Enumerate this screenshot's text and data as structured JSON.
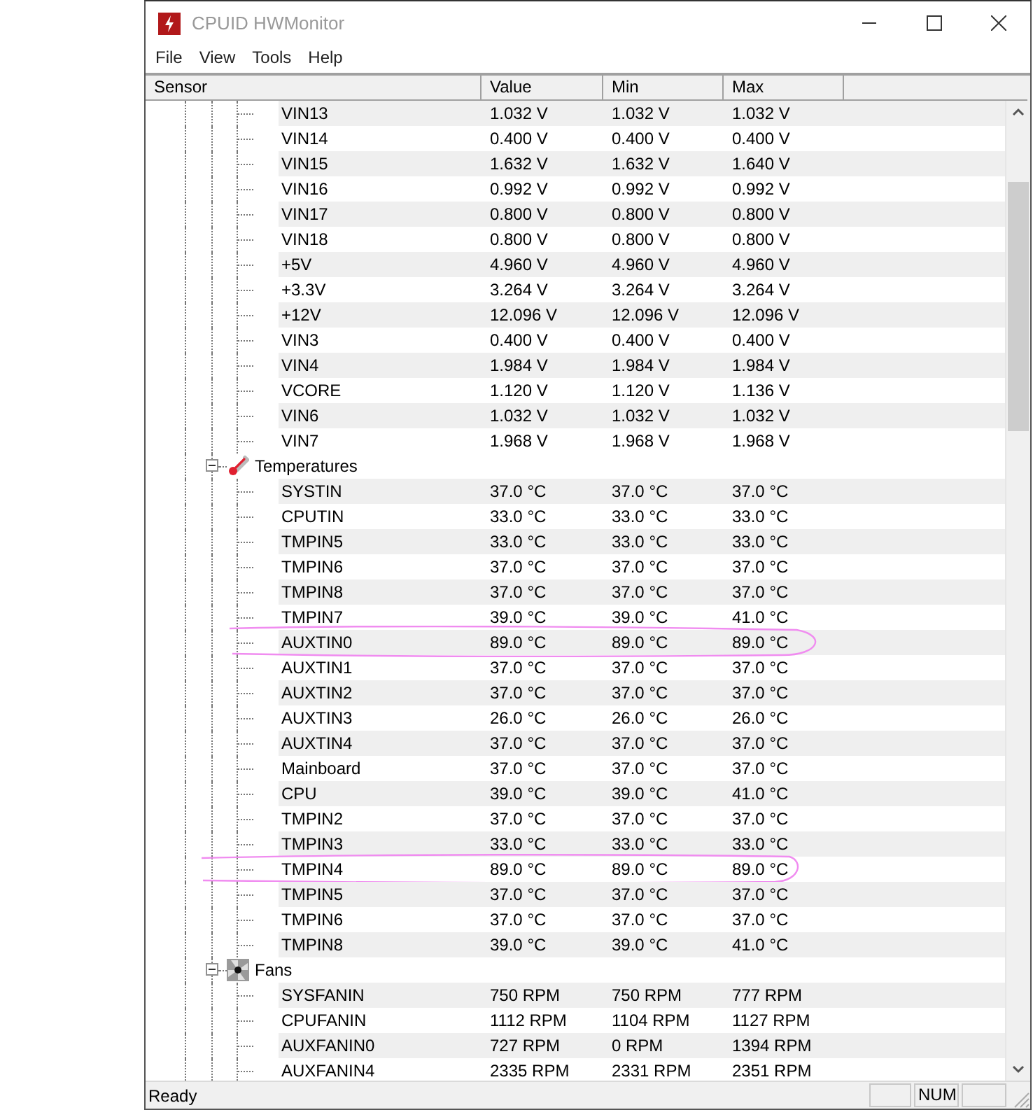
{
  "window": {
    "title": "CPUID HWMonitor"
  },
  "menu": [
    "File",
    "View",
    "Tools",
    "Help"
  ],
  "columns": [
    "Sensor",
    "Value",
    "Min",
    "Max"
  ],
  "sections": [
    {
      "rows": [
        {
          "name": "VIN13",
          "value": "1.032 V",
          "min": "1.032 V",
          "max": "1.032 V",
          "highlighted": false
        },
        {
          "name": "VIN14",
          "value": "0.400 V",
          "min": "0.400 V",
          "max": "0.400 V",
          "highlighted": false
        },
        {
          "name": "VIN15",
          "value": "1.632 V",
          "min": "1.632 V",
          "max": "1.640 V",
          "highlighted": false
        },
        {
          "name": "VIN16",
          "value": "0.992 V",
          "min": "0.992 V",
          "max": "0.992 V",
          "highlighted": false
        },
        {
          "name": "VIN17",
          "value": "0.800 V",
          "min": "0.800 V",
          "max": "0.800 V",
          "highlighted": false
        },
        {
          "name": "VIN18",
          "value": "0.800 V",
          "min": "0.800 V",
          "max": "0.800 V",
          "highlighted": false
        },
        {
          "name": "+5V",
          "value": "4.960 V",
          "min": "4.960 V",
          "max": "4.960 V",
          "highlighted": false
        },
        {
          "name": "+3.3V",
          "value": "3.264 V",
          "min": "3.264 V",
          "max": "3.264 V",
          "highlighted": false
        },
        {
          "name": "+12V",
          "value": "12.096 V",
          "min": "12.096 V",
          "max": "12.096 V",
          "highlighted": false
        },
        {
          "name": "VIN3",
          "value": "0.400 V",
          "min": "0.400 V",
          "max": "0.400 V",
          "highlighted": false
        },
        {
          "name": "VIN4",
          "value": "1.984 V",
          "min": "1.984 V",
          "max": "1.984 V",
          "highlighted": false
        },
        {
          "name": "VCORE",
          "value": "1.120 V",
          "min": "1.120 V",
          "max": "1.136 V",
          "highlighted": false
        },
        {
          "name": "VIN6",
          "value": "1.032 V",
          "min": "1.032 V",
          "max": "1.032 V",
          "highlighted": false
        },
        {
          "name": "VIN7",
          "value": "1.968 V",
          "min": "1.968 V",
          "max": "1.968 V",
          "highlighted": false
        }
      ]
    },
    {
      "label": "Temperatures",
      "kind": "temperatures",
      "expanded": true,
      "rows": [
        {
          "name": "SYSTIN",
          "value": "37.0 °C",
          "min": "37.0 °C",
          "max": "37.0 °C",
          "highlighted": false
        },
        {
          "name": "CPUTIN",
          "value": "33.0 °C",
          "min": "33.0 °C",
          "max": "33.0 °C",
          "highlighted": false
        },
        {
          "name": "TMPIN5",
          "value": "33.0 °C",
          "min": "33.0 °C",
          "max": "33.0 °C",
          "highlighted": false
        },
        {
          "name": "TMPIN6",
          "value": "37.0 °C",
          "min": "37.0 °C",
          "max": "37.0 °C",
          "highlighted": false
        },
        {
          "name": "TMPIN8",
          "value": "37.0 °C",
          "min": "37.0 °C",
          "max": "37.0 °C",
          "highlighted": false
        },
        {
          "name": "TMPIN7",
          "value": "39.0 °C",
          "min": "39.0 °C",
          "max": "41.0 °C",
          "highlighted": false
        },
        {
          "name": "AUXTIN0",
          "value": "89.0 °C",
          "min": "89.0 °C",
          "max": "89.0 °C",
          "highlighted": true
        },
        {
          "name": "AUXTIN1",
          "value": "37.0 °C",
          "min": "37.0 °C",
          "max": "37.0 °C",
          "highlighted": false
        },
        {
          "name": "AUXTIN2",
          "value": "37.0 °C",
          "min": "37.0 °C",
          "max": "37.0 °C",
          "highlighted": false
        },
        {
          "name": "AUXTIN3",
          "value": "26.0 °C",
          "min": "26.0 °C",
          "max": "26.0 °C",
          "highlighted": false
        },
        {
          "name": "AUXTIN4",
          "value": "37.0 °C",
          "min": "37.0 °C",
          "max": "37.0 °C",
          "highlighted": false
        },
        {
          "name": "Mainboard",
          "value": "37.0 °C",
          "min": "37.0 °C",
          "max": "37.0 °C",
          "highlighted": false
        },
        {
          "name": "CPU",
          "value": "39.0 °C",
          "min": "39.0 °C",
          "max": "41.0 °C",
          "highlighted": false
        },
        {
          "name": "TMPIN2",
          "value": "37.0 °C",
          "min": "37.0 °C",
          "max": "37.0 °C",
          "highlighted": false
        },
        {
          "name": "TMPIN3",
          "value": "33.0 °C",
          "min": "33.0 °C",
          "max": "33.0 °C",
          "highlighted": false
        },
        {
          "name": "TMPIN4",
          "value": "89.0 °C",
          "min": "89.0 °C",
          "max": "89.0 °C",
          "highlighted": true
        },
        {
          "name": "TMPIN5",
          "value": "37.0 °C",
          "min": "37.0 °C",
          "max": "37.0 °C",
          "highlighted": false
        },
        {
          "name": "TMPIN6",
          "value": "37.0 °C",
          "min": "37.0 °C",
          "max": "37.0 °C",
          "highlighted": false
        },
        {
          "name": "TMPIN8",
          "value": "39.0 °C",
          "min": "39.0 °C",
          "max": "41.0 °C",
          "highlighted": false
        }
      ]
    },
    {
      "label": "Fans",
      "kind": "fans",
      "expanded": true,
      "rows": [
        {
          "name": "SYSFANIN",
          "value": "750 RPM",
          "min": "750 RPM",
          "max": "777 RPM",
          "highlighted": false
        },
        {
          "name": "CPUFANIN",
          "value": "1112 RPM",
          "min": "1104 RPM",
          "max": "1127 RPM",
          "highlighted": false
        },
        {
          "name": "AUXFANIN0",
          "value": "727 RPM",
          "min": "0 RPM",
          "max": "1394 RPM",
          "highlighted": false
        },
        {
          "name": "AUXFANIN4",
          "value": "2335 RPM",
          "min": "2331 RPM",
          "max": "2351 RPM",
          "highlighted": false
        }
      ]
    }
  ],
  "status_bar": {
    "text": "Ready",
    "num_indicator": "NUM"
  }
}
